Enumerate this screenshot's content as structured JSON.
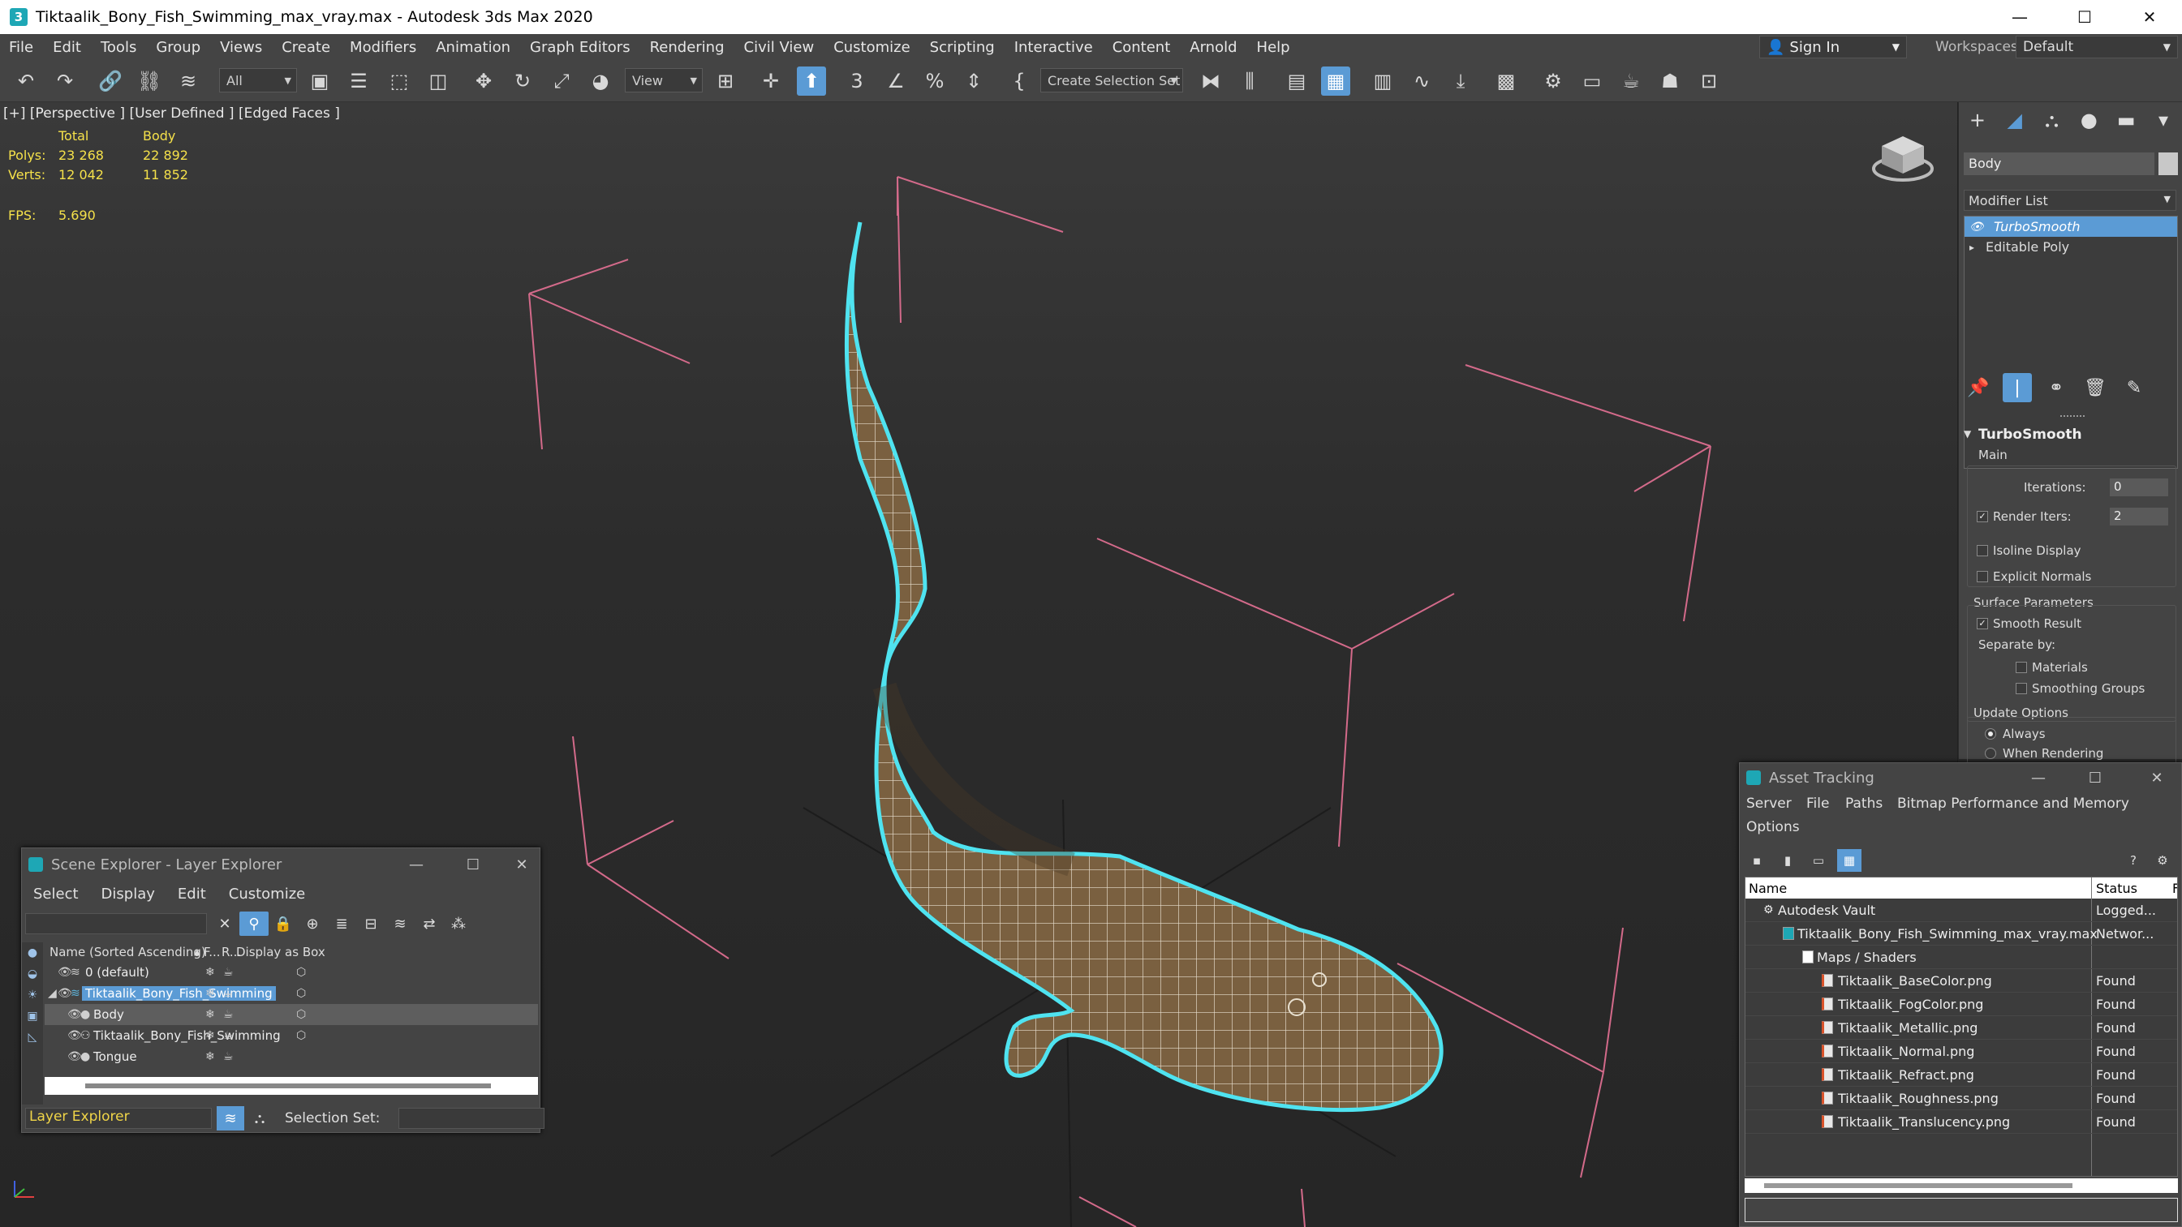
{
  "window": {
    "title": "Tiktaalik_Bony_Fish_Swimming_max_vray.max - Autodesk 3ds Max 2020",
    "app_icon": "3"
  },
  "menubar": [
    "File",
    "Edit",
    "Tools",
    "Group",
    "Views",
    "Create",
    "Modifiers",
    "Animation",
    "Graph Editors",
    "Rendering",
    "Civil View",
    "Customize",
    "Scripting",
    "Interactive",
    "Content",
    "Arnold",
    "Help"
  ],
  "account": {
    "sign_in": "Sign In",
    "workspaces_label": "Workspaces:",
    "workspace": "Default"
  },
  "toolbar": {
    "selection_filter": "All",
    "ref_coord": "View",
    "create_selection_set": "Create Selection Set"
  },
  "viewport": {
    "label": "[+] [Perspective ] [User Defined ] [Edged Faces ]",
    "stats": {
      "header_total": "Total",
      "header_body": "Body",
      "polys_label": "Polys:",
      "polys_total": "23 268",
      "polys_body": "22 892",
      "verts_label": "Verts:",
      "verts_total": "12 042",
      "verts_body": "11 852",
      "fps_label": "FPS:",
      "fps_value": "5.690"
    }
  },
  "command_panel": {
    "object_name": "Body",
    "modifier_list": "Modifier List",
    "stack": [
      "TurboSmooth",
      "Editable Poly"
    ],
    "rollout": {
      "title": "TurboSmooth",
      "main": "Main",
      "iterations_label": "Iterations:",
      "iterations_value": "0",
      "render_iters_label": "Render Iters:",
      "render_iters_value": "2",
      "isoline_display": "Isoline Display",
      "explicit_normals": "Explicit Normals",
      "surface_parameters": "Surface Parameters",
      "smooth_result": "Smooth Result",
      "separate_by": "Separate by:",
      "materials": "Materials",
      "smoothing_groups": "Smoothing Groups",
      "update_options": "Update Options",
      "always": "Always",
      "when_rendering": "When Rendering"
    }
  },
  "scene_explorer": {
    "title": "Scene Explorer - Layer Explorer",
    "menu": [
      "Select",
      "Display",
      "Edit",
      "Customize"
    ],
    "columns": {
      "name": "Name (Sorted Ascending)",
      "sort_indicator": "▲",
      "freeze": "F...",
      "render": "R...",
      "display_as_box": "Display as Box"
    },
    "rows": [
      {
        "name": "0 (default)"
      },
      {
        "name": "Tiktaalik_Bony_Fish_Swimming"
      },
      {
        "name": "Body"
      },
      {
        "name": "Tiktaalik_Bony_Fish_Swimming"
      },
      {
        "name": "Tongue"
      }
    ],
    "explorer_type": "Layer Explorer",
    "selection_set_label": "Selection Set:"
  },
  "asset_tracking": {
    "title": "Asset Tracking",
    "menu": [
      "Server",
      "File",
      "Paths",
      "Bitmap Performance and Memory",
      "Options"
    ],
    "columns": {
      "name": "Name",
      "status": "Status",
      "extra": "F"
    },
    "rows": [
      {
        "name": "Autodesk Vault",
        "status": "Logged..."
      },
      {
        "name": "Tiktaalik_Bony_Fish_Swimming_max_vray.max",
        "status": "Networ..."
      },
      {
        "name": "Maps / Shaders",
        "status": ""
      },
      {
        "name": "Tiktaalik_BaseColor.png",
        "status": "Found"
      },
      {
        "name": "Tiktaalik_FogColor.png",
        "status": "Found"
      },
      {
        "name": "Tiktaalik_Metallic.png",
        "status": "Found"
      },
      {
        "name": "Tiktaalik_Normal.png",
        "status": "Found"
      },
      {
        "name": "Tiktaalik_Refract.png",
        "status": "Found"
      },
      {
        "name": "Tiktaalik_Roughness.png",
        "status": "Found"
      },
      {
        "name": "Tiktaalik_Translucency.png",
        "status": "Found"
      }
    ]
  },
  "colors": {
    "accent": "#5b9bd5",
    "stats_text": "#f5e14a",
    "bbox_lines": "#d36a8a",
    "selection_outline": "#4fe3f0"
  }
}
